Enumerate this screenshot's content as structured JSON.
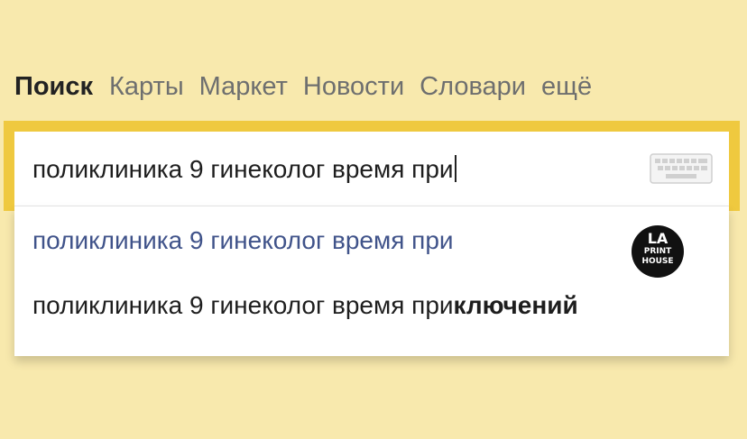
{
  "nav": {
    "items": [
      {
        "label": "Поиск",
        "active": true
      },
      {
        "label": "Карты"
      },
      {
        "label": "Маркет"
      },
      {
        "label": "Новости"
      },
      {
        "label": "Словари"
      },
      {
        "label": "ещё"
      }
    ]
  },
  "search": {
    "value": "поликлиника 9 гинеколог время при",
    "icon": "keyboard-icon"
  },
  "suggestions": [
    {
      "prefix": "поликлиника 9 гинеколог время при",
      "completion": ""
    },
    {
      "prefix": "поликлиника 9 гинеколог время при",
      "completion": "ключений"
    }
  ],
  "watermark": {
    "line1": "LA",
    "line2": "PRINT",
    "line3": "HOUSE"
  },
  "colors": {
    "background": "#f8e9ad",
    "search_border": "#efc93f",
    "suggestion_link": "#40538a"
  }
}
